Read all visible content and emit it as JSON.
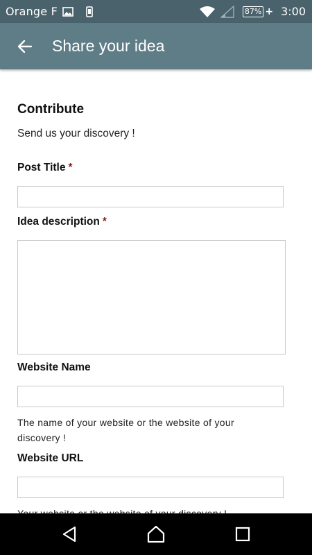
{
  "status_bar": {
    "carrier": "Orange F",
    "battery_percent": "87%",
    "time": "3:00",
    "icons": [
      "image-icon",
      "phone-vibrate-icon",
      "wifi-icon",
      "signal-icon",
      "battery-icon",
      "charging-icon"
    ]
  },
  "app_bar": {
    "title": "Share your idea",
    "back_icon": "arrow-left-icon"
  },
  "form": {
    "heading": "Contribute",
    "subtext": "Send us your discovery !",
    "required_marker": "*",
    "post_title": {
      "label": "Post Title",
      "value": "",
      "required": true
    },
    "idea_description": {
      "label": "Idea description",
      "value": "",
      "required": true
    },
    "website_name": {
      "label": "Website Name",
      "value": "",
      "help": "The name of your website or the website of your discovery !"
    },
    "website_url": {
      "label": "Website URL",
      "value": "",
      "help": "Your website or the website of your discovery !"
    }
  },
  "nav_bar": {
    "icons": [
      "back-triangle-icon",
      "home-icon",
      "recents-square-icon"
    ]
  },
  "colors": {
    "status_bar": "#4a626c",
    "app_bar": "#5f7d87",
    "required": "#8b1a1a",
    "nav_bar": "#000000"
  }
}
